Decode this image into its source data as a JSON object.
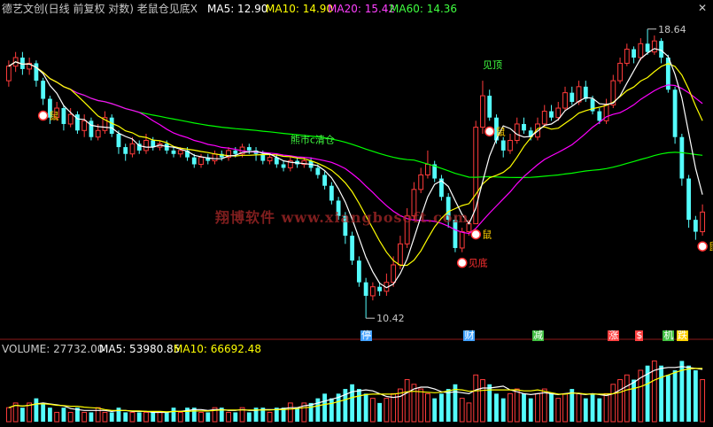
{
  "header": {
    "title": "德艺文创(日线 前复权 对数) 老鼠仓见底X",
    "ma5": "MA5: 12.90",
    "ma10": "MA10: 14.90",
    "ma20": "MA20: 15.42",
    "ma60": "MA60: 14.36"
  },
  "volume_header": {
    "volume": "VOLUME: 27732.00",
    "ma5": "MA5: 53980.85",
    "ma10": "MA10: 66692.48"
  },
  "watermark": "翔博软件 www.xiangbosoft.com",
  "annotations": {
    "high": "18.64",
    "low": "10.42",
    "signal_top": "见顶",
    "signal_bottom": "见底",
    "signal_mid": "熊市c清仓",
    "mouse": "鼠"
  },
  "events": [
    {
      "label": "停",
      "color": "#40a0ff"
    },
    {
      "label": "财",
      "color": "#40a0ff"
    },
    {
      "label": "减",
      "color": "#40c040"
    },
    {
      "label": "涨",
      "color": "#ff4040"
    },
    {
      "label": "$",
      "color": "#ff4040"
    },
    {
      "label": "机",
      "color": "#40c040"
    },
    {
      "label": "跌",
      "color": "#ffd000"
    }
  ],
  "colors": {
    "up": "#ff3b3b",
    "down": "#54fcfc",
    "ma5": "#ffffff",
    "ma10": "#ffff00",
    "ma20": "#ff00ff",
    "ma60": "#00ff00"
  },
  "chart_data": {
    "type": "candlestick",
    "price_range": [
      10.42,
      18.64
    ],
    "price_axis": "log",
    "ma_last": {
      "MA5": 12.9,
      "MA10": 14.9,
      "MA20": 15.42,
      "MA60": 14.36
    },
    "high": 18.64,
    "low": 10.42,
    "candles": [
      [
        16.8,
        17.3,
        17.5,
        16.6
      ],
      [
        17.3,
        17.6,
        17.8,
        17.1
      ],
      [
        17.6,
        17.2,
        17.8,
        17.0
      ],
      [
        17.2,
        17.4,
        17.6,
        17.0
      ],
      [
        17.4,
        16.8,
        17.5,
        16.6
      ],
      [
        16.8,
        16.2,
        16.9,
        16.0
      ],
      [
        16.2,
        15.6,
        16.3,
        15.4
      ],
      [
        15.6,
        15.9,
        16.1,
        15.5
      ],
      [
        15.9,
        15.4,
        16.0,
        15.2
      ],
      [
        15.4,
        15.7,
        15.9,
        15.3
      ],
      [
        15.7,
        15.2,
        15.8,
        15.1
      ],
      [
        15.2,
        15.5,
        15.7,
        15.0
      ],
      [
        15.5,
        15.0,
        15.6,
        14.9
      ],
      [
        15.0,
        15.2,
        15.4,
        14.9
      ],
      [
        15.2,
        15.6,
        15.8,
        15.1
      ],
      [
        15.6,
        15.1,
        15.7,
        15.0
      ],
      [
        15.1,
        14.7,
        15.2,
        14.5
      ],
      [
        14.7,
        14.5,
        14.8,
        14.3
      ],
      [
        14.5,
        14.8,
        15.0,
        14.4
      ],
      [
        14.8,
        14.6,
        14.9,
        14.5
      ],
      [
        14.6,
        14.9,
        15.1,
        14.5
      ],
      [
        14.9,
        14.7,
        15.0,
        14.6
      ],
      [
        14.7,
        14.8,
        14.9,
        14.6
      ],
      [
        14.8,
        14.6,
        14.9,
        14.5
      ],
      [
        14.6,
        14.5,
        14.7,
        14.4
      ],
      [
        14.5,
        14.6,
        14.7,
        14.4
      ],
      [
        14.6,
        14.4,
        14.7,
        14.3
      ],
      [
        14.4,
        14.2,
        14.5,
        14.1
      ],
      [
        14.2,
        14.4,
        14.5,
        14.1
      ],
      [
        14.4,
        14.3,
        14.5,
        14.2
      ],
      [
        14.3,
        14.5,
        14.6,
        14.2
      ],
      [
        14.5,
        14.4,
        14.6,
        14.3
      ],
      [
        14.4,
        14.6,
        14.7,
        14.3
      ],
      [
        14.6,
        14.5,
        14.7,
        14.4
      ],
      [
        14.5,
        14.7,
        14.8,
        14.4
      ],
      [
        14.7,
        14.6,
        14.8,
        14.5
      ],
      [
        14.6,
        14.5,
        14.7,
        14.3
      ],
      [
        14.5,
        14.3,
        14.6,
        14.2
      ],
      [
        14.3,
        14.4,
        14.5,
        14.2
      ],
      [
        14.4,
        14.2,
        14.5,
        14.1
      ],
      [
        14.2,
        14.1,
        14.3,
        14.0
      ],
      [
        14.1,
        14.3,
        14.4,
        14.0
      ],
      [
        14.3,
        14.2,
        14.4,
        14.1
      ],
      [
        14.2,
        14.3,
        14.4,
        14.1
      ],
      [
        14.3,
        14.1,
        14.4,
        14.0
      ],
      [
        14.1,
        13.9,
        14.2,
        13.8
      ],
      [
        13.9,
        13.6,
        14.0,
        13.5
      ],
      [
        13.6,
        13.2,
        13.7,
        13.1
      ],
      [
        13.2,
        12.8,
        13.3,
        12.7
      ],
      [
        12.8,
        12.3,
        12.9,
        12.1
      ],
      [
        12.3,
        11.7,
        12.4,
        11.6
      ],
      [
        11.7,
        11.2,
        11.8,
        11.1
      ],
      [
        11.2,
        10.9,
        11.3,
        10.42
      ],
      [
        10.9,
        11.1,
        11.2,
        10.8
      ],
      [
        11.1,
        11.0,
        11.2,
        10.9
      ],
      [
        11.0,
        11.2,
        11.4,
        10.9
      ],
      [
        11.2,
        11.6,
        11.8,
        11.1
      ],
      [
        11.6,
        12.1,
        12.3,
        11.5
      ],
      [
        12.1,
        12.8,
        13.0,
        12.0
      ],
      [
        12.8,
        13.5,
        13.7,
        12.7
      ],
      [
        13.5,
        13.9,
        14.1,
        13.4
      ],
      [
        13.9,
        14.2,
        14.6,
        13.8
      ],
      [
        14.2,
        13.8,
        14.3,
        13.7
      ],
      [
        13.8,
        13.3,
        13.9,
        13.2
      ],
      [
        13.3,
        12.7,
        13.4,
        12.5
      ],
      [
        12.7,
        12.0,
        12.8,
        11.9
      ],
      [
        12.0,
        12.4,
        12.5,
        11.9
      ],
      [
        12.4,
        12.6,
        12.7,
        12.3
      ],
      [
        12.6,
        15.3,
        15.5,
        12.6
      ],
      [
        15.3,
        16.3,
        16.8,
        15.1
      ],
      [
        16.3,
        15.6,
        16.5,
        15.5
      ],
      [
        15.6,
        14.9,
        15.7,
        14.8
      ],
      [
        14.9,
        14.6,
        15.0,
        14.4
      ],
      [
        14.6,
        14.9,
        15.1,
        14.5
      ],
      [
        14.9,
        15.4,
        15.6,
        14.8
      ],
      [
        15.4,
        15.2,
        15.6,
        15.1
      ],
      [
        15.2,
        15.0,
        15.3,
        14.9
      ],
      [
        15.0,
        15.4,
        15.6,
        14.9
      ],
      [
        15.4,
        15.8,
        16.0,
        15.3
      ],
      [
        15.8,
        15.6,
        16.0,
        15.5
      ],
      [
        15.6,
        15.9,
        16.1,
        15.5
      ],
      [
        15.9,
        16.4,
        16.6,
        15.8
      ],
      [
        16.4,
        16.1,
        16.6,
        16.0
      ],
      [
        16.1,
        16.6,
        16.8,
        16.0
      ],
      [
        16.6,
        16.2,
        16.8,
        16.1
      ],
      [
        16.2,
        15.8,
        16.3,
        15.7
      ],
      [
        15.8,
        15.5,
        15.9,
        15.4
      ],
      [
        15.5,
        16.0,
        16.2,
        15.4
      ],
      [
        16.0,
        16.8,
        17.0,
        15.9
      ],
      [
        16.8,
        17.4,
        17.6,
        16.7
      ],
      [
        17.4,
        17.9,
        18.1,
        17.3
      ],
      [
        17.9,
        17.6,
        18.0,
        17.4
      ],
      [
        17.6,
        18.1,
        18.3,
        17.5
      ],
      [
        18.1,
        17.8,
        18.64,
        17.7
      ],
      [
        17.8,
        18.2,
        18.4,
        17.7
      ],
      [
        18.2,
        17.6,
        18.3,
        17.4
      ],
      [
        17.6,
        16.5,
        17.7,
        16.4
      ],
      [
        16.5,
        15.0,
        16.6,
        14.8
      ],
      [
        15.0,
        13.8,
        15.1,
        13.6
      ],
      [
        13.8,
        12.7,
        13.9,
        12.5
      ],
      [
        12.7,
        12.4,
        12.8,
        12.2
      ],
      [
        12.4,
        12.9,
        13.1,
        12.3
      ]
    ],
    "volume_last": 27732.0,
    "volume_ma": {
      "MA5": 53980.85,
      "MA10": 66692.48
    },
    "volume": [
      3,
      4,
      3,
      4,
      5,
      4,
      3,
      2,
      3,
      2,
      3,
      2,
      2,
      3,
      2,
      2,
      3,
      2,
      2,
      2,
      2,
      2,
      2,
      2,
      3,
      2,
      3,
      3,
      2,
      2,
      3,
      3,
      2,
      2,
      3,
      2,
      3,
      3,
      2,
      3,
      3,
      4,
      3,
      4,
      4,
      5,
      6,
      5,
      6,
      7,
      8,
      7,
      6,
      5,
      4,
      5,
      6,
      7,
      9,
      8,
      7,
      6,
      5,
      6,
      7,
      8,
      5,
      4,
      10,
      9,
      8,
      6,
      5,
      6,
      7,
      6,
      5,
      6,
      7,
      6,
      5,
      6,
      7,
      6,
      5,
      6,
      5,
      6,
      8,
      9,
      10,
      9,
      11,
      12,
      13,
      12,
      10,
      11,
      13,
      12,
      11,
      9
    ]
  }
}
